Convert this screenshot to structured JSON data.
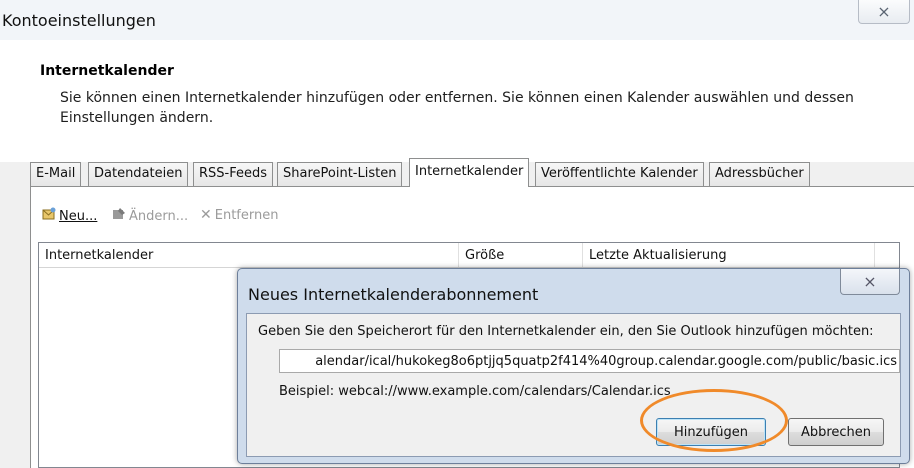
{
  "window": {
    "title": "Kontoeinstellungen",
    "close_glyph": "⨯"
  },
  "header": {
    "title": "Internetkalender",
    "description": "Sie können einen Internetkalender hinzufügen oder entfernen. Sie können einen Kalender auswählen und dessen Einstellungen ändern."
  },
  "tabs": [
    {
      "label": "E-Mail"
    },
    {
      "label": "Datendateien"
    },
    {
      "label": "RSS-Feeds"
    },
    {
      "label": "SharePoint-Listen"
    },
    {
      "label": "Internetkalender"
    },
    {
      "label": "Veröffentlichte Kalender"
    },
    {
      "label": "Adressbücher"
    }
  ],
  "toolbar": {
    "new_label": "Neu...",
    "change_label": "Ändern...",
    "remove_label": "Entfernen"
  },
  "list": {
    "columns": [
      "Internetkalender",
      "Größe",
      "Letzte Aktualisierung"
    ]
  },
  "dialog": {
    "title": "Neues Internetkalenderabonnement",
    "close_glyph": "⨯",
    "prompt": "Geben Sie den Speicherort für den Internetkalender ein, den Sie Outlook hinzufügen möchten:",
    "url_value": "alendar/ical/hukokeg8o6ptjjq5quatp2f414%40group.calendar.google.com/public/basic.ics",
    "example": "Beispiel: webcal://www.example.com/calendars/Calendar.ics",
    "add_label": "Hinzufügen",
    "cancel_label": "Abbrechen"
  },
  "colors": {
    "highlight": "#f08a2a",
    "dialog_frame": "#cfdcec"
  }
}
